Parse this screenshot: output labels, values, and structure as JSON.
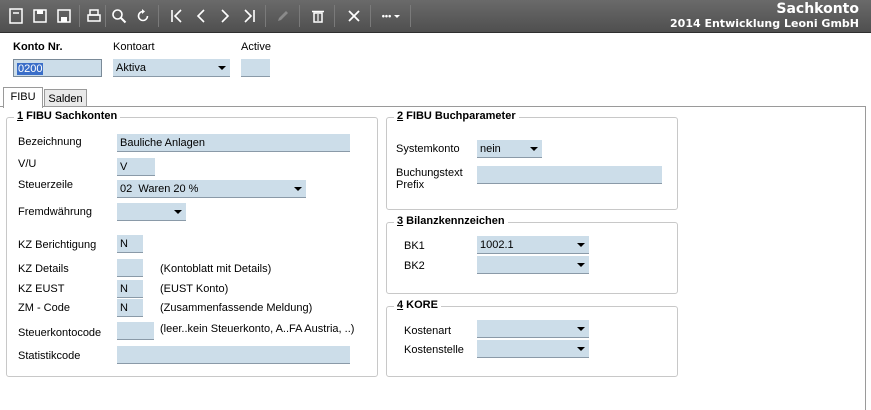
{
  "window": {
    "title": "Sachkonto",
    "subtitle": "2014 Entwicklung Leoni GmbH"
  },
  "toolbar": {
    "buttons": [
      {
        "name": "new-icon"
      },
      {
        "name": "save-icon"
      },
      {
        "name": "save-close-icon"
      },
      {
        "name": "print-icon"
      },
      {
        "name": "search-icon"
      },
      {
        "name": "refresh-icon"
      },
      {
        "name": "first-record-icon"
      },
      {
        "name": "previous-record-icon"
      },
      {
        "name": "next-record-icon"
      },
      {
        "name": "last-record-icon"
      },
      {
        "name": "edit-icon"
      },
      {
        "name": "delete-icon"
      },
      {
        "name": "close-icon"
      },
      {
        "name": "more-icon"
      }
    ],
    "more_label": "•••"
  },
  "header": {
    "konto_nr_label": "Konto Nr.",
    "konto_nr_value": "0200",
    "kontoart_label": "Kontoart",
    "kontoart_value": "Aktiva",
    "active_label": "Active",
    "active_value": ""
  },
  "tabs": [
    {
      "label": "FIBU",
      "active": true
    },
    {
      "label": "Salden",
      "active": false
    }
  ],
  "fibu_sachkonten": {
    "title_num": "1",
    "title_text": " FIBU Sachkonten",
    "bezeichnung_label": "Bezeichnung",
    "bezeichnung_value": "Bauliche Anlagen",
    "vu_label": "V/U",
    "vu_value": "V",
    "steuerzeile_label": "Steuerzeile",
    "steuerzeile_value": "02  Waren 20 %",
    "fremdwaehrung_label": "Fremdwährung",
    "fremdwaehrung_value": "",
    "kz_berichtigung_label": "KZ Berichtigung",
    "kz_berichtigung_value": "N",
    "kz_details_label": "KZ Details",
    "kz_details_value": "",
    "kz_details_hint": "(Kontoblatt mit Details)",
    "kz_eust_label": "KZ EUST",
    "kz_eust_value": "N",
    "kz_eust_hint": "(EUST Konto)",
    "zm_code_label": "ZM - Code",
    "zm_code_value": "N",
    "zm_code_hint": "(Zusammenfassende Meldung)",
    "steuerkontocode_label": "Steuerkontocode",
    "steuerkontocode_value": "",
    "steuerkontocode_hint": "(leer..kein Steuerkonto, A..FA Austria, ..)",
    "statistikcode_label": "Statistikcode",
    "statistikcode_value": ""
  },
  "fibu_buchparameter": {
    "title_num": "2",
    "title_text": " FIBU Buchparameter",
    "systemkonto_label": "Systemkonto",
    "systemkonto_value": "nein",
    "buchungstext_label_1": "Buchungstext",
    "buchungstext_label_2": "Prefix",
    "buchungstext_value": ""
  },
  "bilanzkennzeichen": {
    "title_num": "3",
    "title_text": " Bilanzkennzeichen",
    "bk1_label": "BK1",
    "bk1_value": "1002.1",
    "bk2_label": "BK2",
    "bk2_value": ""
  },
  "kore": {
    "title_num": "4",
    "title_text": " KORE",
    "kostenart_label": "Kostenart",
    "kostenart_value": "",
    "kostenstelle_label": "Kostenstelle",
    "kostenstelle_value": ""
  },
  "colors": {
    "toolbar_bg": "#5a5a5a",
    "field_bg": "#ccdde9",
    "selection": "#3a6ec8"
  }
}
